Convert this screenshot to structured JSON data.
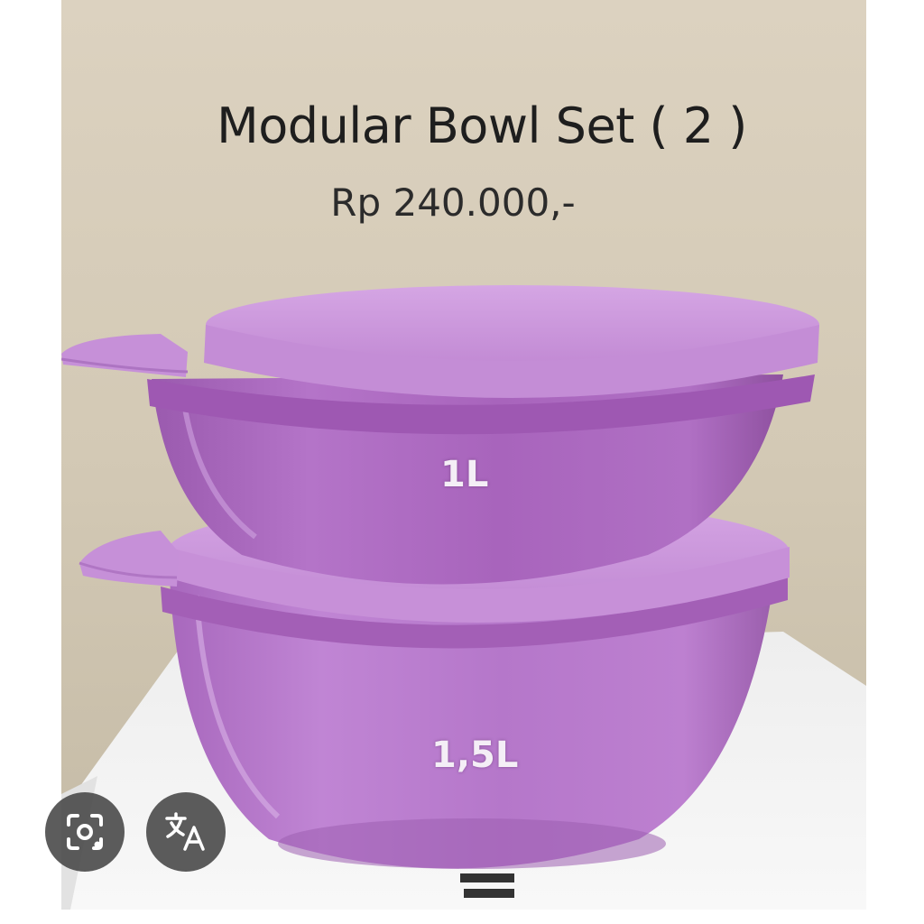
{
  "image": {
    "title": "Modular Bowl Set ( 2 )",
    "price": "Rp 240.000,-",
    "labels": {
      "small_bowl": "1L",
      "large_bowl": "1,5L"
    }
  },
  "overlay_buttons": {
    "visual_search_icon": "camera-search-icon",
    "translate_icon": "translate-icon"
  },
  "colors": {
    "wall": "#d6ccb9",
    "bowl_purple": "#b070c4",
    "lid_purple": "#c38fd6",
    "button_bg": "#464646"
  }
}
